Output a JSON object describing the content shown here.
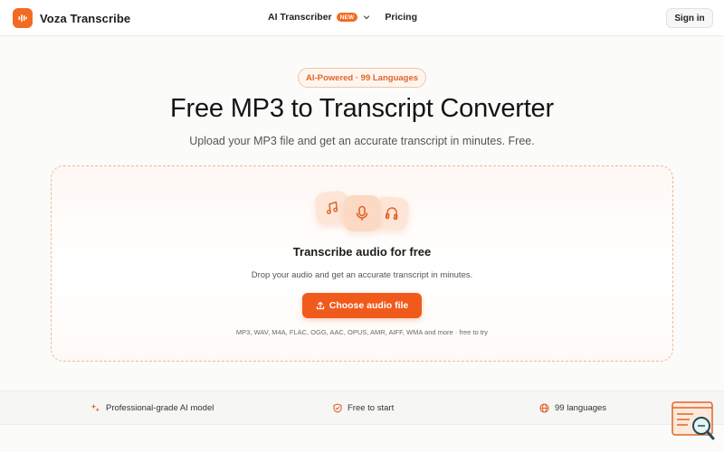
{
  "header": {
    "brand": "Voza Transcribe",
    "nav": {
      "ai_transcriber": "AI Transcriber",
      "new_badge": "NEW",
      "pricing": "Pricing"
    },
    "sign_in": "Sign in"
  },
  "hero": {
    "pill": "AI-Powered · 99 Languages",
    "title": "Free MP3 to Transcript Converter",
    "subtitle": "Upload your MP3 file and get an accurate transcript in minutes. Free."
  },
  "upload": {
    "icons": [
      "music-note-icon",
      "microphone-icon",
      "audio-file-icon"
    ],
    "title": "Transcribe audio for free",
    "description": "Drop your audio and get an accurate transcript in minutes.",
    "button": "Choose audio file",
    "formats": "MP3, WAV, M4A, FLAC, OGG, AAC, OPUS, AMR, AIFF, WMA and more · free to try"
  },
  "features": [
    {
      "icon": "sparkle-icon",
      "label": "Professional-grade AI model"
    },
    {
      "icon": "shield-check-icon",
      "label": "Free to start"
    },
    {
      "icon": "globe-icon",
      "label": "99 languages"
    }
  ],
  "colors": {
    "accent": "#f05a1a",
    "accent_soft": "#fde6d8",
    "border_dashed": "#f2b796"
  }
}
